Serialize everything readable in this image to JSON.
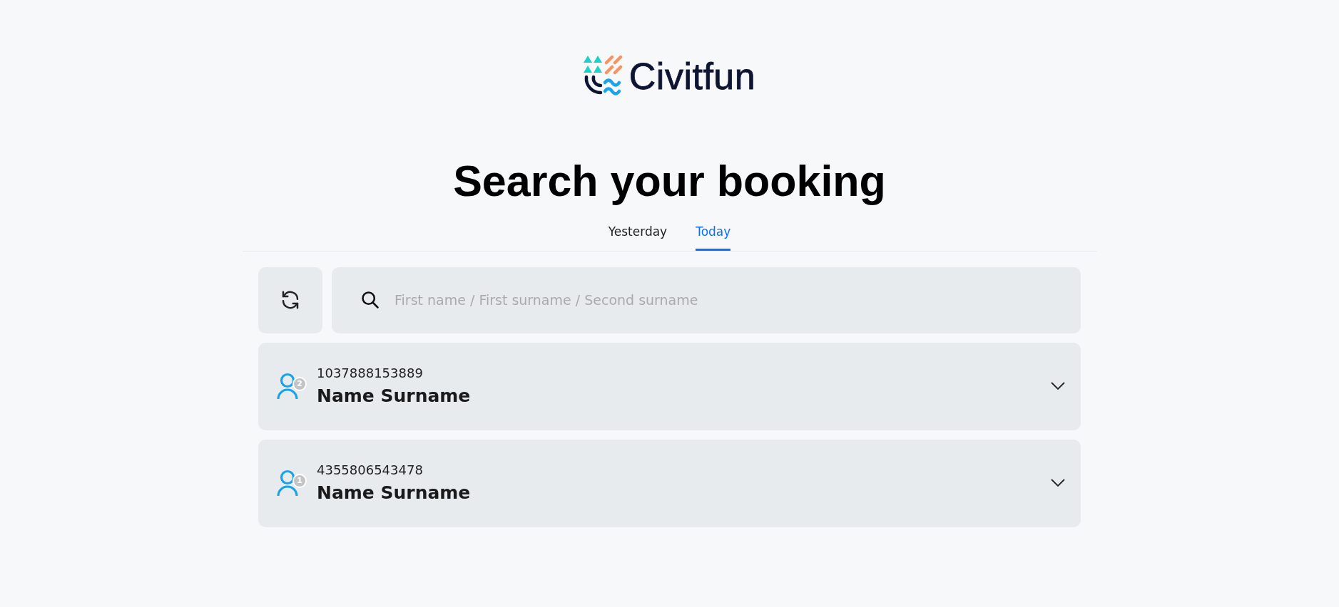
{
  "logo": {
    "text": "Civitfun"
  },
  "title": "Search your booking",
  "tabs": [
    {
      "label": "Yesterday",
      "selected": false
    },
    {
      "label": "Today",
      "selected": true
    }
  ],
  "search": {
    "placeholder": "First name / First surname / Second surname"
  },
  "bookings": [
    {
      "code": "1037888153889",
      "name": "Name Surname",
      "guests": "2",
      "expanded": false
    },
    {
      "code": "4355806543478",
      "name": "Name Surname",
      "guests": "1",
      "expanded": false
    }
  ]
}
